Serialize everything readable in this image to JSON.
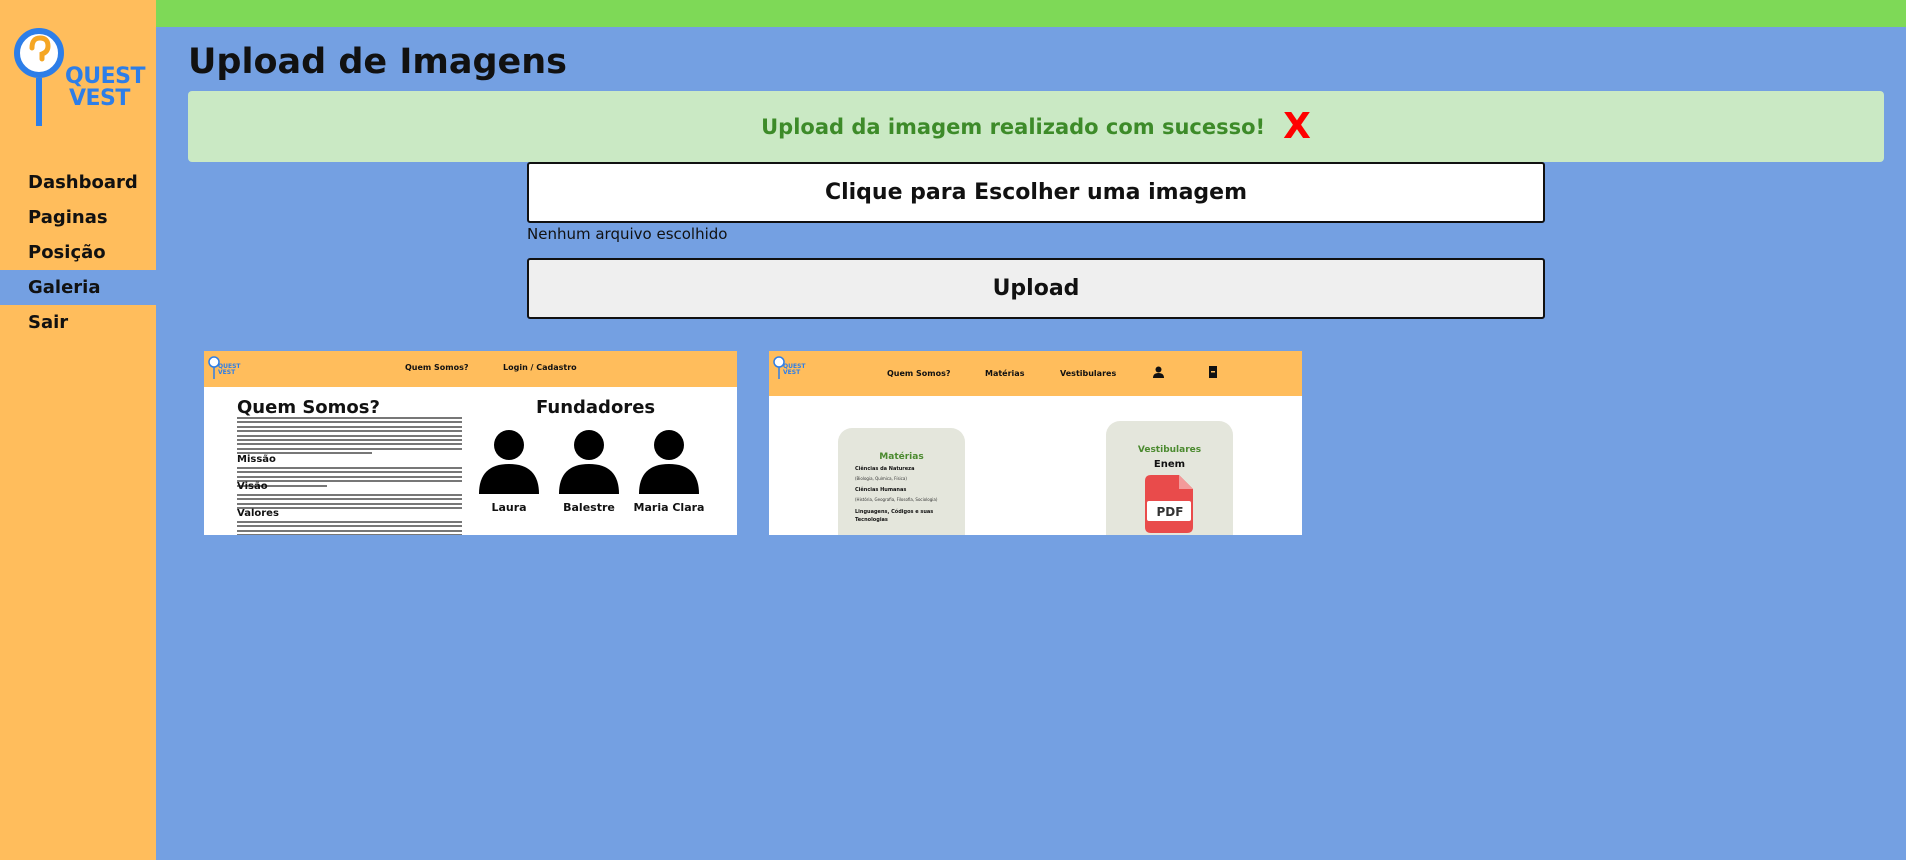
{
  "brand": {
    "logo_line1": "QUEST",
    "logo_line2": "VEST"
  },
  "sidebar": {
    "items": [
      {
        "label": "Dashboard",
        "name": "sidebar-item-dashboard",
        "active": false
      },
      {
        "label": "Paginas",
        "name": "sidebar-item-paginas",
        "active": false
      },
      {
        "label": "Posição",
        "name": "sidebar-item-posicao",
        "active": false
      },
      {
        "label": "Galeria",
        "name": "sidebar-item-galeria",
        "active": true
      },
      {
        "label": "Sair",
        "name": "sidebar-item-sair",
        "active": false
      }
    ]
  },
  "colors": {
    "sidebar_bg": "#ffbd5c",
    "main_bg": "#74a0e2",
    "topbar_bg": "#7ed957",
    "alert_bg": "#cae9c4",
    "alert_text": "#3d8b29",
    "close_x": "#ff0000"
  },
  "page": {
    "title": "Upload de Imagens"
  },
  "alert": {
    "message": "Upload da imagem realizado com sucesso!",
    "close_label": "X"
  },
  "upload_form": {
    "choose_label": "Clique para Escolher uma imagem",
    "file_status": "Nenhum arquivo escolhido",
    "upload_label": "Upload"
  },
  "gallery": {
    "thumb1": {
      "nav": [
        "Quem Somos?",
        "Login / Cadastro"
      ],
      "title": "Quem Somos?",
      "headings": [
        "Missão",
        "Visão",
        "Valores"
      ],
      "founders_title": "Fundadores",
      "founders": [
        "Laura",
        "Balestre",
        "Maria Clara"
      ]
    },
    "thumb2": {
      "nav": [
        "Quem Somos?",
        "Matérias",
        "Vestibulares"
      ],
      "icons": [
        "user-icon",
        "door-icon"
      ],
      "card1": {
        "title": "Matérias",
        "sections": [
          "Ciências da Natureza",
          "Ciências Humanas",
          "Linguagens, Códigos e suas Tecnologias"
        ],
        "subs": [
          "(Biologia, Química, Física)",
          "(História, Geografia, Filosofia, Sociologia)"
        ]
      },
      "card2": {
        "title": "Vestibulares",
        "sub": "Enem",
        "pdf_label": "PDF"
      }
    }
  }
}
